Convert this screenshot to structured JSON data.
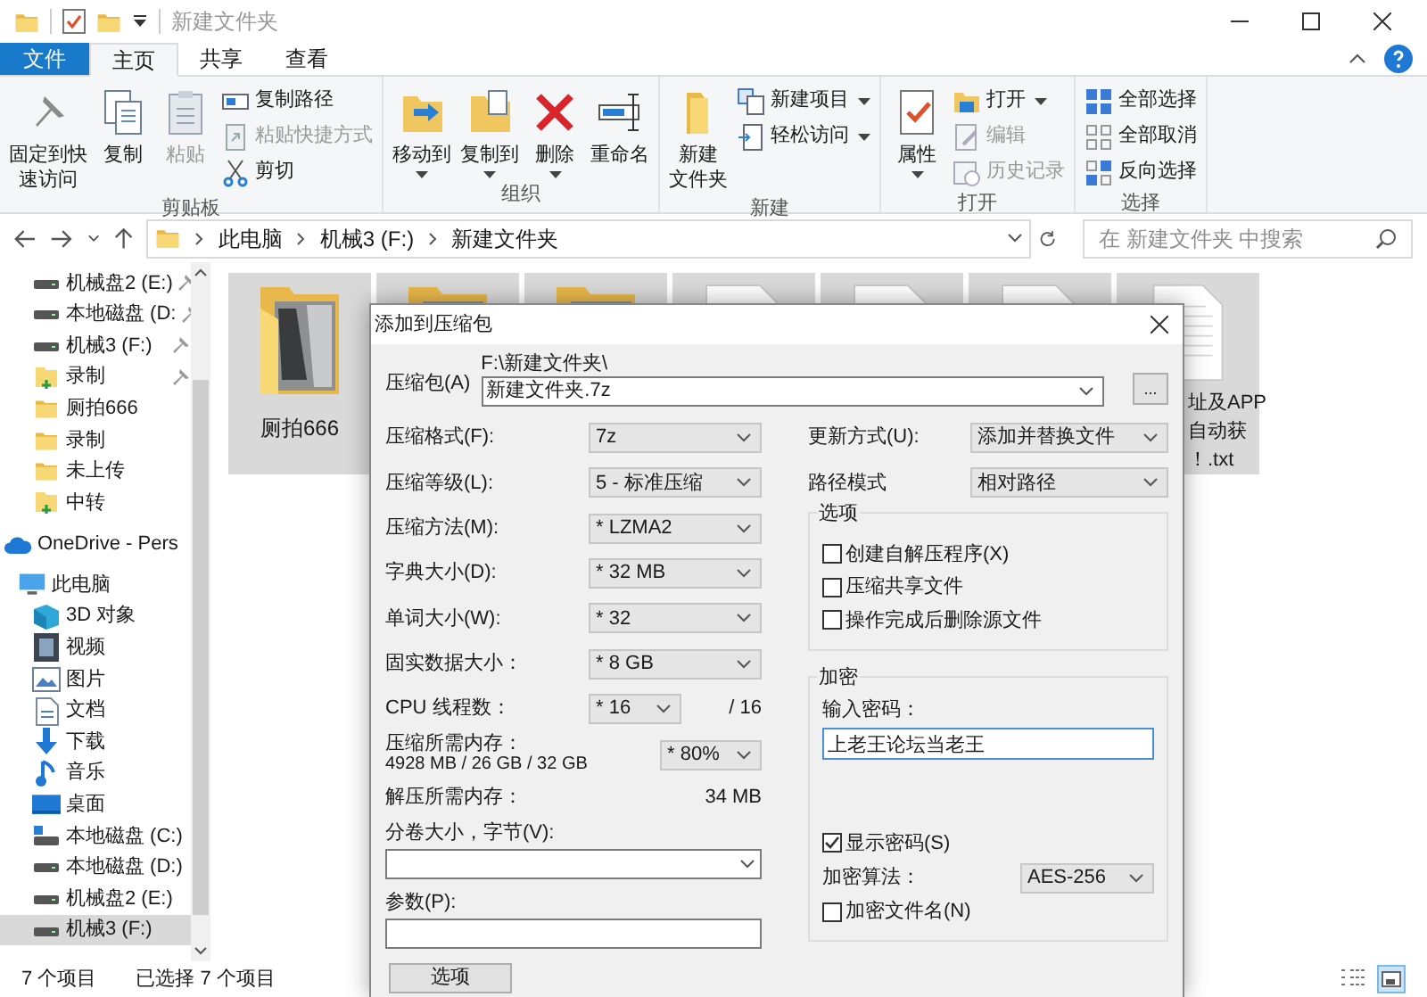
{
  "window": {
    "title": "新建文件夹"
  },
  "ribbon_tabs": [
    {
      "label": "文件",
      "kind": "file",
      "selected": false
    },
    {
      "label": "主页",
      "kind": "tab",
      "selected": true
    },
    {
      "label": "共享",
      "kind": "tab",
      "selected": false
    },
    {
      "label": "查看",
      "kind": "tab",
      "selected": false
    }
  ],
  "ribbon_groups": [
    {
      "label": "剪贴板",
      "items": [
        {
          "kind": "large",
          "lines": [
            "固定到快",
            "速访问"
          ],
          "disabled": false,
          "dropdown": false
        },
        {
          "kind": "large",
          "lines": [
            "复制"
          ],
          "disabled": false,
          "dropdown": false
        },
        {
          "kind": "large",
          "lines": [
            "粘贴"
          ],
          "disabled": true,
          "dropdown": false
        },
        {
          "kind": "small",
          "label": "复制路径",
          "disabled": false,
          "dropdown": false
        },
        {
          "kind": "small",
          "label": "粘贴快捷方式",
          "disabled": true,
          "dropdown": false
        },
        {
          "kind": "small",
          "label": "剪切",
          "disabled": false,
          "dropdown": false
        }
      ]
    },
    {
      "label": "组织",
      "items": [
        {
          "kind": "large",
          "lines": [
            "移动到"
          ],
          "disabled": false,
          "dropdown": true
        },
        {
          "kind": "large",
          "lines": [
            "复制到"
          ],
          "disabled": false,
          "dropdown": true
        },
        {
          "kind": "large",
          "lines": [
            "删除"
          ],
          "disabled": false,
          "dropdown": true
        },
        {
          "kind": "large",
          "lines": [
            "重命名"
          ],
          "disabled": false,
          "dropdown": false
        }
      ]
    },
    {
      "label": "新建",
      "items": [
        {
          "kind": "large",
          "lines": [
            "新建",
            "文件夹"
          ],
          "disabled": false,
          "dropdown": false
        },
        {
          "kind": "small",
          "label": "新建项目",
          "disabled": false,
          "dropdown": true
        },
        {
          "kind": "small",
          "label": "轻松访问",
          "disabled": false,
          "dropdown": true
        }
      ]
    },
    {
      "label": "打开",
      "items": [
        {
          "kind": "large",
          "lines": [
            "属性"
          ],
          "disabled": false,
          "dropdown": true
        },
        {
          "kind": "small",
          "label": "打开",
          "disabled": false,
          "dropdown": true
        },
        {
          "kind": "small",
          "label": "编辑",
          "disabled": true,
          "dropdown": false
        },
        {
          "kind": "small",
          "label": "历史记录",
          "disabled": true,
          "dropdown": false
        }
      ]
    },
    {
      "label": "选择",
      "items": [
        {
          "kind": "small",
          "label": "全部选择",
          "disabled": false,
          "dropdown": false
        },
        {
          "kind": "small",
          "label": "全部取消",
          "disabled": false,
          "dropdown": false
        },
        {
          "kind": "small",
          "label": "反向选择",
          "disabled": false,
          "dropdown": false
        }
      ]
    }
  ],
  "address_bar": {
    "path": [
      "此电脑",
      "机械3 (F:)",
      "新建文件夹"
    ],
    "search_placeholder": "在 新建文件夹 中搜索"
  },
  "sidebar": {
    "quick_access": [
      {
        "label": "机械盘2 (E:)",
        "kind": "drive",
        "pinned": true
      },
      {
        "label": "本地磁盘 (D:",
        "kind": "drive",
        "pinned": true
      },
      {
        "label": "机械3 (F:)",
        "kind": "drive",
        "pinned": true
      },
      {
        "label": "录制",
        "kind": "folder-green",
        "pinned": true
      },
      {
        "label": "厕拍666",
        "kind": "folder",
        "pinned": false
      },
      {
        "label": "录制",
        "kind": "folder",
        "pinned": false
      },
      {
        "label": "未上传",
        "kind": "folder",
        "pinned": false
      },
      {
        "label": "中转",
        "kind": "folder-green",
        "pinned": false
      }
    ],
    "items": [
      {
        "label": "OneDrive - Pers",
        "kind": "cloud",
        "selected": false
      },
      {
        "label": "此电脑",
        "kind": "pc",
        "selected": false,
        "children": [
          {
            "label": "3D 对象",
            "kind": "cube",
            "selected": false
          },
          {
            "label": "视频",
            "kind": "video",
            "selected": false
          },
          {
            "label": "图片",
            "kind": "picture",
            "selected": false
          },
          {
            "label": "文档",
            "kind": "doc",
            "selected": false
          },
          {
            "label": "下载",
            "kind": "download",
            "selected": false
          },
          {
            "label": "音乐",
            "kind": "music",
            "selected": false
          },
          {
            "label": "桌面",
            "kind": "desktop",
            "selected": false
          },
          {
            "label": "本地磁盘 (C:)",
            "kind": "system-drive",
            "selected": false
          },
          {
            "label": "本地磁盘 (D:)",
            "kind": "drive",
            "selected": false
          },
          {
            "label": "机械盘2 (E:)",
            "kind": "drive",
            "selected": false
          },
          {
            "label": "机械3 (F:)",
            "kind": "drive",
            "selected": true
          }
        ]
      }
    ]
  },
  "files": [
    {
      "kind": "photo-folder",
      "label": "厕拍666",
      "selected": true
    },
    {
      "kind": "photo-folder",
      "selected": true
    },
    {
      "kind": "photo-folder",
      "selected": true
    },
    {
      "kind": "text-file",
      "selected": true
    },
    {
      "kind": "text-file",
      "selected": true
    },
    {
      "kind": "text-file",
      "selected": true
    },
    {
      "kind": "text-file",
      "selected": true,
      "label_lines": [
        "址及APP",
        "自动获",
        "！.txt"
      ]
    }
  ],
  "status_bar": {
    "count": "7 个项目",
    "selection": "已选择 7 个项目"
  },
  "dialog": {
    "title": "添加到压缩包",
    "archive": {
      "label": "压缩包(A)",
      "path": "F:\\新建文件夹\\",
      "value": "新建文件夹.7z",
      "browse": "..."
    },
    "settings": [
      {
        "kind": "select",
        "label": "压缩格式(F):",
        "value": "7z"
      },
      {
        "kind": "select",
        "label": "压缩等级(L):",
        "value": "5 - 标准压缩"
      },
      {
        "kind": "select",
        "label": "压缩方法(M):",
        "value": "* LZMA2"
      },
      {
        "kind": "select",
        "label": "字典大小(D):",
        "value": "* 32 MB"
      },
      {
        "kind": "select",
        "label": "单词大小(W):",
        "value": "* 32"
      },
      {
        "kind": "select",
        "label": "固实数据大小：",
        "value": "* 8 GB"
      },
      {
        "kind": "select-short",
        "label": "CPU 线程数：",
        "value": "* 16",
        "note": "/ 16"
      },
      {
        "kind": "memory",
        "label": "压缩所需内存：",
        "sublabel": "4928 MB / 26 GB / 32 GB",
        "value": "* 80%"
      },
      {
        "kind": "info",
        "label": "解压所需内存：",
        "value": "34 MB"
      }
    ],
    "volume": {
      "label": "分卷大小，字节(V):"
    },
    "parameters": {
      "label": "参数(P):"
    },
    "options_button": "选项",
    "update_mode": {
      "label": "更新方式(U):",
      "value": "添加并替换文件"
    },
    "path_mode": {
      "label": "路径模式",
      "value": "相对路径"
    },
    "options": {
      "title": "选项",
      "items": [
        {
          "label": "创建自解压程序(X)",
          "checked": false
        },
        {
          "label": "压缩共享文件",
          "checked": false
        },
        {
          "label": "操作完成后删除源文件",
          "checked": false
        }
      ]
    },
    "encryption": {
      "title": "加密",
      "password_label": "输入密码：",
      "password": "上老王论坛当老王",
      "show_password": {
        "label": "显示密码(S)",
        "checked": true
      },
      "method_label": "加密算法：",
      "method": "AES-256",
      "encrypt_names": {
        "label": "加密文件名(N)",
        "checked": false
      }
    }
  }
}
